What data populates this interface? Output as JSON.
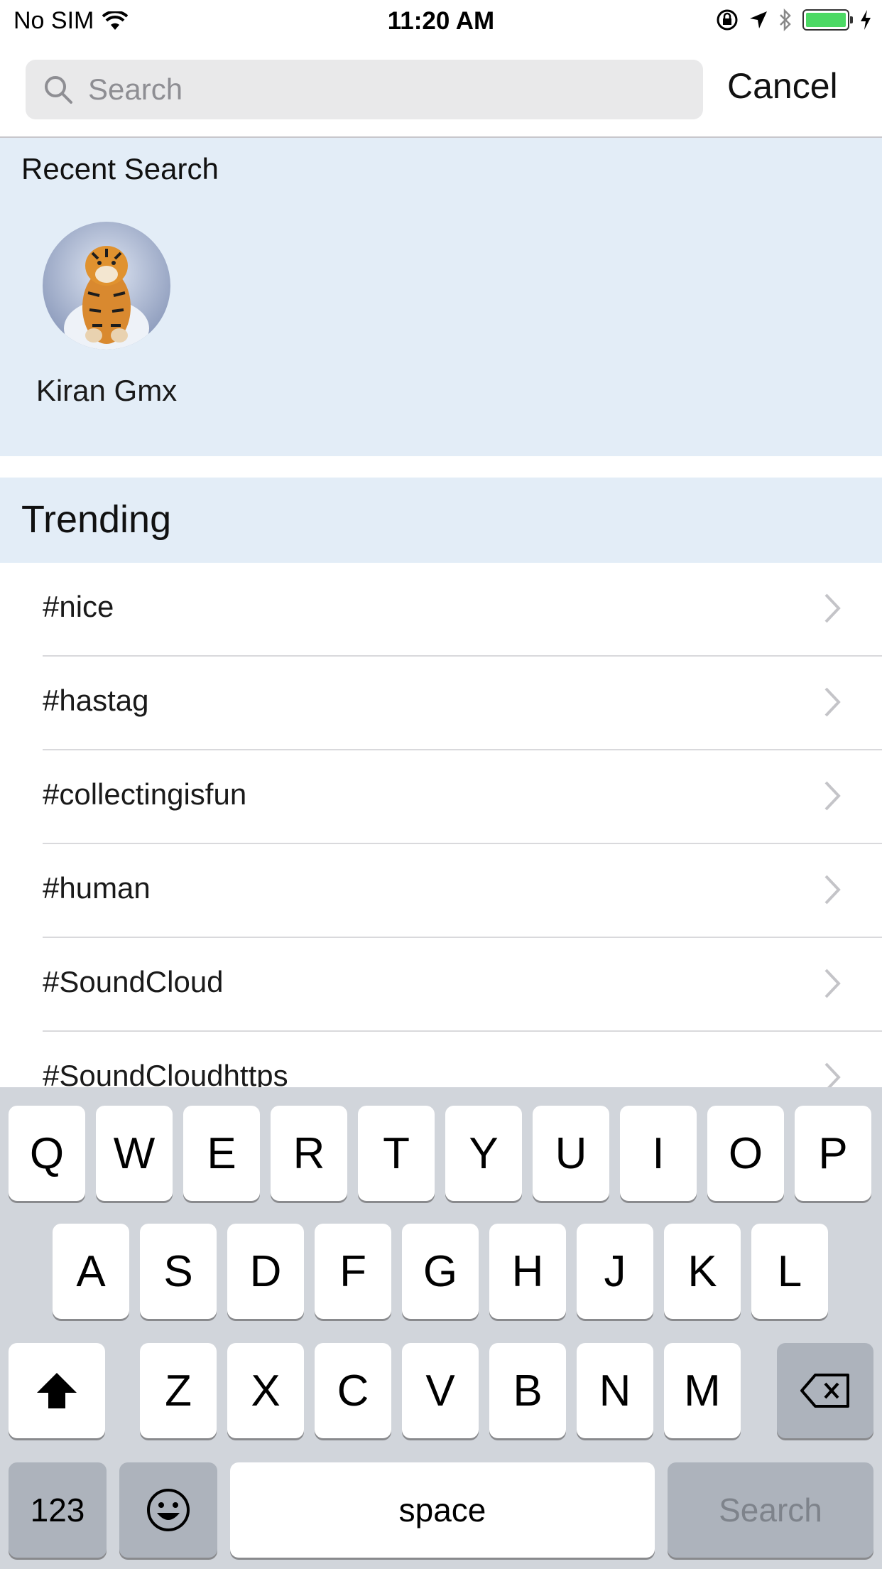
{
  "status_bar": {
    "carrier": "No SIM",
    "time": "11:20 AM",
    "battery_color": "#4cd964"
  },
  "search": {
    "placeholder": "Search",
    "value": "",
    "cancel_label": "Cancel"
  },
  "recent": {
    "title": "Recent Search",
    "items": [
      {
        "name": "Kiran Gmx",
        "avatar": "tiger-photo"
      }
    ]
  },
  "trending": {
    "title": "Trending",
    "items": [
      {
        "label": "#nice"
      },
      {
        "label": "#hastag"
      },
      {
        "label": "#collectingisfun"
      },
      {
        "label": "#human"
      },
      {
        "label": "#SoundCloud"
      },
      {
        "label": "#SoundCloudhttps"
      }
    ]
  },
  "keyboard": {
    "row1": [
      "Q",
      "W",
      "E",
      "R",
      "T",
      "Y",
      "U",
      "I",
      "O",
      "P"
    ],
    "row2": [
      "A",
      "S",
      "D",
      "F",
      "G",
      "H",
      "J",
      "K",
      "L"
    ],
    "row3": [
      "Z",
      "X",
      "C",
      "V",
      "B",
      "N",
      "M"
    ],
    "numbers_label": "123",
    "space_label": "space",
    "return_label": "Search",
    "shift_icon": "shift-icon",
    "delete_icon": "backspace-icon",
    "emoji_icon": "emoji-icon"
  },
  "colors": {
    "section_bg": "#e3edf7",
    "keyboard_bg": "#d1d5db",
    "dark_key": "#adb3bc"
  }
}
